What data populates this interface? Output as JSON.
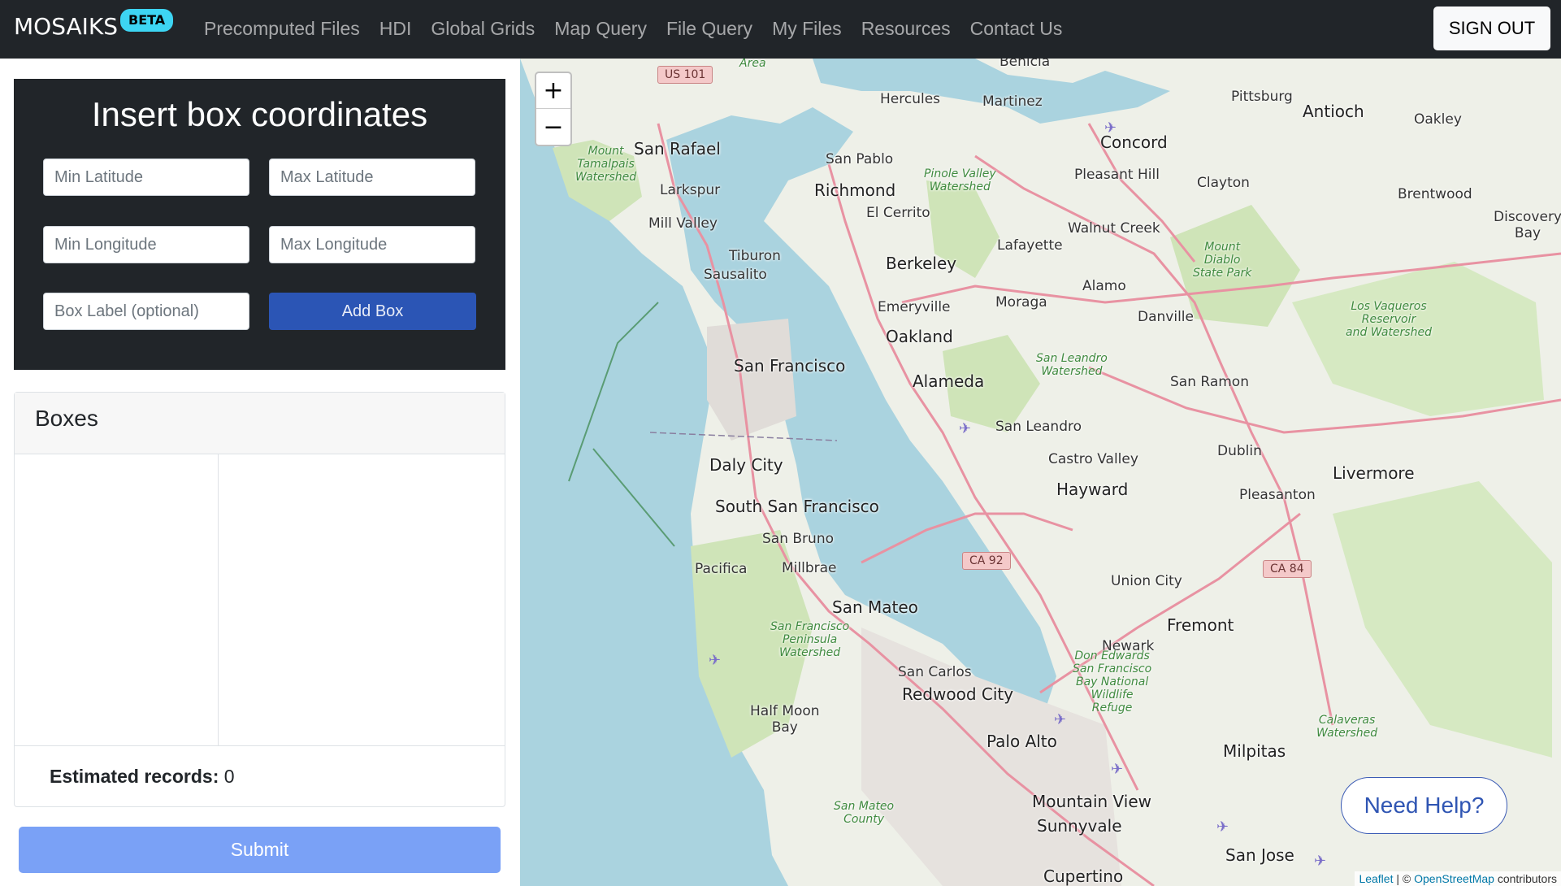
{
  "navbar": {
    "brand": "MOSAIKS",
    "badge": "BETA",
    "links": [
      "Precomputed Files",
      "HDI",
      "Global Grids",
      "Map Query",
      "File Query",
      "My Files",
      "Resources",
      "Contact Us"
    ],
    "sign_out": "SIGN OUT"
  },
  "coords_form": {
    "title": "Insert box coordinates",
    "min_lat_placeholder": "Min Latitude",
    "max_lat_placeholder": "Max Latitude",
    "min_lon_placeholder": "Min Longitude",
    "max_lon_placeholder": "Max Longitude",
    "label_placeholder": "Box Label (optional)",
    "add_box": "Add Box"
  },
  "boxes": {
    "title": "Boxes",
    "estimated_label": "Estimated records:",
    "estimated_value": "0"
  },
  "submit": "Submit",
  "map": {
    "zoom_in": "+",
    "zoom_out": "−",
    "help": "Need Help?",
    "attribution": {
      "leaflet": "Leaflet",
      "sep": " | © ",
      "osm": "OpenStreetMap",
      "suffix": " contributors"
    },
    "places": {
      "sf": "San Francisco",
      "oakland": "Oakland",
      "berkeley": "Berkeley",
      "richmond": "Richmond",
      "sanrafael": "San Rafael",
      "concord": "Concord",
      "antioch": "Antioch",
      "hayward": "Hayward",
      "fremont": "Fremont",
      "sanmateo": "San Mateo",
      "redwood": "Redwood City",
      "paloalto": "Palo Alto",
      "mountainview": "Mountain View",
      "sunnyvale": "Sunnyvale",
      "sanjose": "San Jose",
      "milpitas": "Milpitas",
      "livermore": "Livermore",
      "dalycity": "Daly City",
      "ssf": "South San Francisco",
      "alameda": "Alameda",
      "sanleandro": "San Leandro",
      "castrovalley": "Castro Valley",
      "dublin": "Dublin",
      "pleasanton": "Pleasanton",
      "sanramon": "San Ramon",
      "danville": "Danville",
      "alamo": "Alamo",
      "walnutcreek": "Walnut Creek",
      "lafayette": "Lafayette",
      "moraga": "Moraga",
      "pleasanthill": "Pleasant Hill",
      "clayton": "Clayton",
      "brentwood": "Brentwood",
      "oakley": "Oakley",
      "pittsburg": "Pittsburg",
      "martinez": "Martinez",
      "hercules": "Hercules",
      "sanpablo": "San Pablo",
      "elcerrito": "El Cerrito",
      "emeryville": "Emeryville",
      "tiburon": "Tiburon",
      "sausalito": "Sausalito",
      "millvalley": "Mill Valley",
      "larkspur": "Larkspur",
      "sanbruno": "San Bruno",
      "millbrae": "Millbrae",
      "pacifica": "Pacifica",
      "sancarlos": "San Carlos",
      "halfmoonbay": "Half Moon\nBay",
      "unioncity": "Union City",
      "newark": "Newark",
      "cupertino": "Cupertino",
      "benicia": "Benicia",
      "discoverybay": "Discovery\nBay",
      "area": "Area"
    },
    "green_areas": {
      "tamalpais": "Mount\nTamalpais\nWatershed",
      "pinole": "Pinole Valley\nWatershed",
      "diablo": "Mount\nDiablo\nState Park",
      "vaqueros": "Los Vaqueros\nReservoir\nand Watershed",
      "sanleandrows": "San Leandro\nWatershed",
      "sfpeninsula": "San Francisco\nPeninsula\nWatershed",
      "donedwards": "Don Edwards\nSan Francisco\nBay National\nWildlife\nRefuge",
      "calaveras": "Calaveras\nWatershed",
      "smcounty": "San Mateo\nCounty"
    },
    "shields": {
      "us101": "US 101",
      "ca92": "CA 92",
      "ca84": "CA 84"
    }
  }
}
